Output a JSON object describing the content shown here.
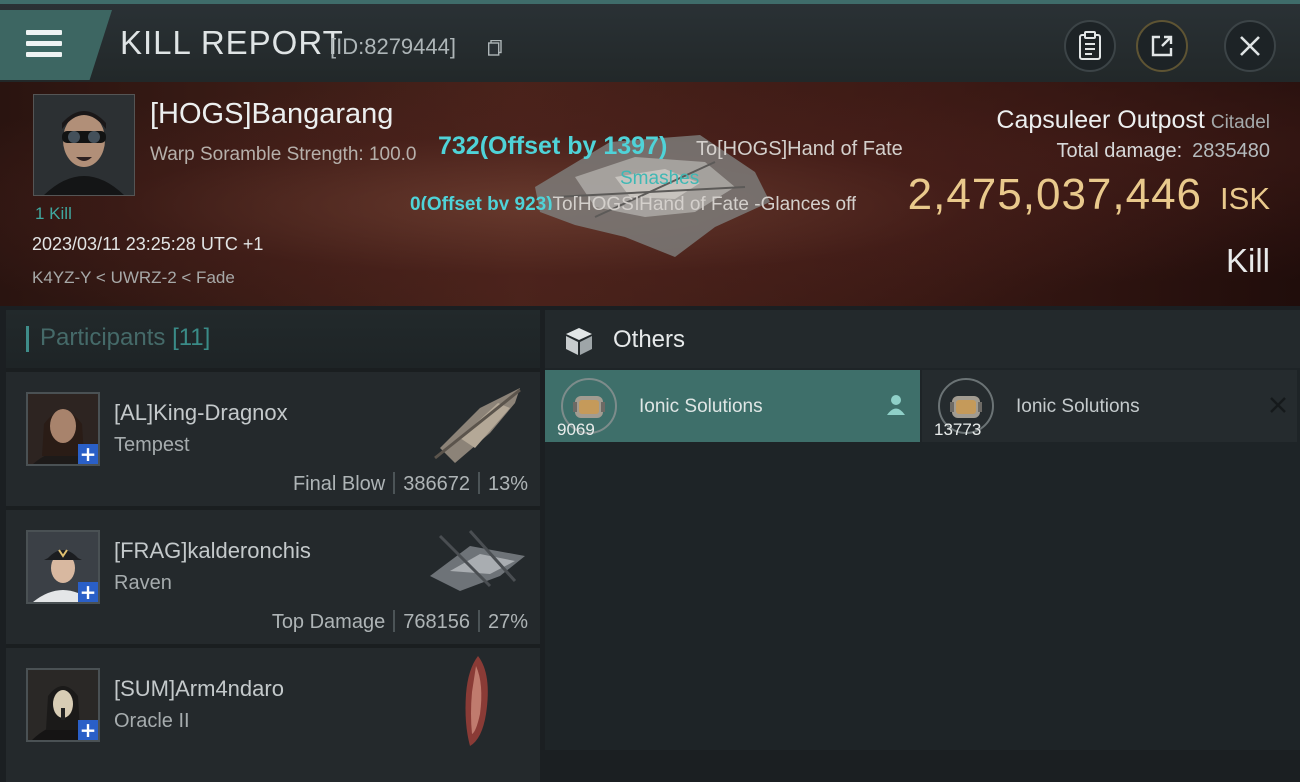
{
  "header": {
    "title": "KILL REPORT",
    "report_id": "[ID:8279444]"
  },
  "victim": {
    "pilot_name": "[HOGS]Bangarang",
    "warp_scramble_label": "Warp Soramble Strength: 100.0",
    "kill_count": "1 Kill",
    "timestamp": "2023/03/11 23:25:28 UTC +1",
    "location": "K4YZ-Y < UWRZ-2 < Fade",
    "structure_name": "Capsuleer Outpost",
    "structure_class": "Citadel",
    "total_damage_label": "Total damage:",
    "total_damage_value": "2835480",
    "isk_value": "2,475,037,446",
    "isk_unit": "ISK",
    "result_label": "Kill"
  },
  "combat_log": {
    "damage_text": "732(Offset by 1397)",
    "target_text": "To[HOGS]Hand of Fate",
    "weapon_text": "Smashes",
    "miss_prefix": "0(Offset by 923)",
    "miss_text": "To[HOGS]Hand of Fate -Glances off"
  },
  "participants": {
    "header_label": "Participants",
    "header_count": "[11]",
    "items": [
      {
        "name": "[AL]King-Dragnox",
        "ship": "Tempest",
        "role": "Final Blow",
        "damage": "386672",
        "percent": "13%"
      },
      {
        "name": "[FRAG]kalderonchis",
        "ship": "Raven",
        "role": "Top Damage",
        "damage": "768156",
        "percent": "27%"
      },
      {
        "name": "[SUM]Arm4ndaro",
        "ship": "Oracle II"
      }
    ]
  },
  "others": {
    "header_label": "Others",
    "items": [
      {
        "name": "Ionic Solutions",
        "quantity": "9069"
      },
      {
        "name": "Ionic Solutions",
        "quantity": "13773"
      }
    ]
  },
  "colors": {
    "accent": "#3f8d8a",
    "isk_gold": "#e9c98c",
    "combat_cyan": "#4fd3d8",
    "selected_item": "#3e6f6a"
  }
}
